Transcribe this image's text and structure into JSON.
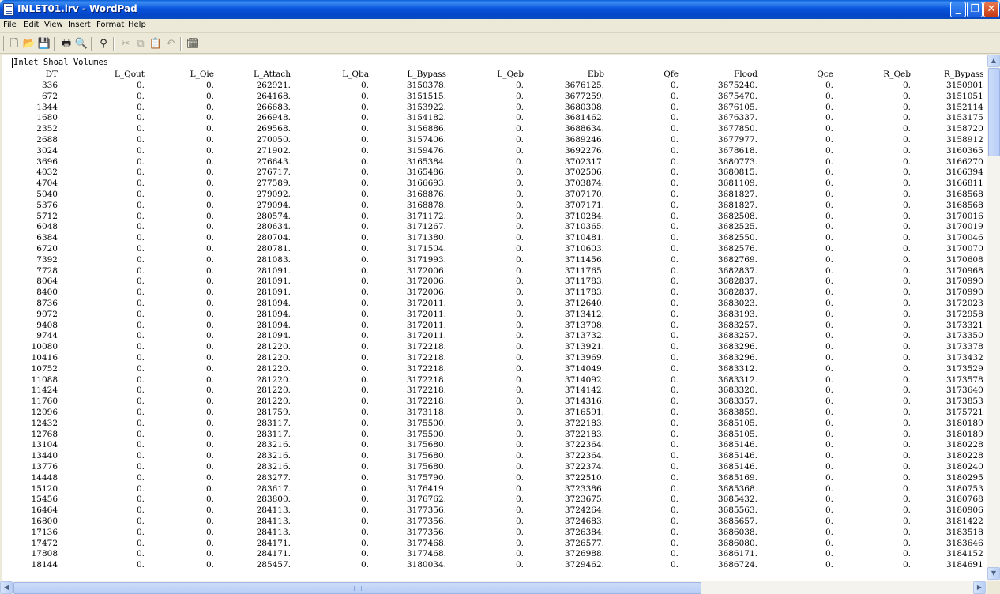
{
  "window": {
    "title": "INLET01.irv - WordPad",
    "minimize_glyph": "_",
    "maximize_glyph": "❐",
    "close_glyph": "✕"
  },
  "menu": [
    "File",
    "Edit",
    "View",
    "Insert",
    "Format",
    "Help"
  ],
  "toolbar": {
    "tools": [
      {
        "name": "new-icon",
        "glyph": "🗋"
      },
      {
        "name": "open-icon",
        "glyph": "📂"
      },
      {
        "name": "save-icon",
        "glyph": "💾"
      },
      {
        "name": "print-icon",
        "glyph": "🖶"
      },
      {
        "name": "print-preview-icon",
        "glyph": "🔍"
      },
      {
        "name": "find-icon",
        "glyph": "⚲"
      },
      {
        "name": "cut-icon",
        "glyph": "✂"
      },
      {
        "name": "copy-icon",
        "glyph": "⧉"
      },
      {
        "name": "paste-icon",
        "glyph": "📋"
      },
      {
        "name": "undo-icon",
        "glyph": "↶"
      },
      {
        "name": "date-time-icon",
        "glyph": "🗓"
      }
    ]
  },
  "document": {
    "title": "Inlet Shoal Volumes",
    "columns": [
      "DT",
      "L_Qout",
      "L_Qie",
      "L_Attach",
      "L_Qba",
      "L_Bypass",
      "L_Qeb",
      "Ebb",
      "Qfe",
      "Flood",
      "Qce",
      "R_Qeb",
      "R_Bypass"
    ],
    "rows": [
      [
        "336",
        "0.",
        "0.",
        "262921.",
        "0.",
        "3150378.",
        "0.",
        "3676125.",
        "0.",
        "3675240.",
        "0.",
        "0.",
        "3150901"
      ],
      [
        "672",
        "0.",
        "0.",
        "264168.",
        "0.",
        "3151515.",
        "0.",
        "3677259.",
        "0.",
        "3675470.",
        "0.",
        "0.",
        "3151051"
      ],
      [
        "1344",
        "0.",
        "0.",
        "266683.",
        "0.",
        "3153922.",
        "0.",
        "3680308.",
        "0.",
        "3676105.",
        "0.",
        "0.",
        "3152114"
      ],
      [
        "1680",
        "0.",
        "0.",
        "266948.",
        "0.",
        "3154182.",
        "0.",
        "3681462.",
        "0.",
        "3676337.",
        "0.",
        "0.",
        "3153175"
      ],
      [
        "2352",
        "0.",
        "0.",
        "269568.",
        "0.",
        "3156886.",
        "0.",
        "3688634.",
        "0.",
        "3677850.",
        "0.",
        "0.",
        "3158720"
      ],
      [
        "2688",
        "0.",
        "0.",
        "270050.",
        "0.",
        "3157406.",
        "0.",
        "3689246.",
        "0.",
        "3677977.",
        "0.",
        "0.",
        "3158912"
      ],
      [
        "3024",
        "0.",
        "0.",
        "271902.",
        "0.",
        "3159476.",
        "0.",
        "3692276.",
        "0.",
        "3678618.",
        "0.",
        "0.",
        "3160365"
      ],
      [
        "3696",
        "0.",
        "0.",
        "276643.",
        "0.",
        "3165384.",
        "0.",
        "3702317.",
        "0.",
        "3680773.",
        "0.",
        "0.",
        "3166270"
      ],
      [
        "4032",
        "0.",
        "0.",
        "276717.",
        "0.",
        "3165486.",
        "0.",
        "3702506.",
        "0.",
        "3680815.",
        "0.",
        "0.",
        "3166394"
      ],
      [
        "4704",
        "0.",
        "0.",
        "277589.",
        "0.",
        "3166693.",
        "0.",
        "3703874.",
        "0.",
        "3681109.",
        "0.",
        "0.",
        "3166811"
      ],
      [
        "5040",
        "0.",
        "0.",
        "279092.",
        "0.",
        "3168876.",
        "0.",
        "3707170.",
        "0.",
        "3681827.",
        "0.",
        "0.",
        "3168568"
      ],
      [
        "5376",
        "0.",
        "0.",
        "279094.",
        "0.",
        "3168878.",
        "0.",
        "3707171.",
        "0.",
        "3681827.",
        "0.",
        "0.",
        "3168568"
      ],
      [
        "5712",
        "0.",
        "0.",
        "280574.",
        "0.",
        "3171172.",
        "0.",
        "3710284.",
        "0.",
        "3682508.",
        "0.",
        "0.",
        "3170016"
      ],
      [
        "6048",
        "0.",
        "0.",
        "280634.",
        "0.",
        "3171267.",
        "0.",
        "3710365.",
        "0.",
        "3682525.",
        "0.",
        "0.",
        "3170019"
      ],
      [
        "6384",
        "0.",
        "0.",
        "280704.",
        "0.",
        "3171380.",
        "0.",
        "3710481.",
        "0.",
        "3682550.",
        "0.",
        "0.",
        "3170046"
      ],
      [
        "6720",
        "0.",
        "0.",
        "280781.",
        "0.",
        "3171504.",
        "0.",
        "3710603.",
        "0.",
        "3682576.",
        "0.",
        "0.",
        "3170070"
      ],
      [
        "7392",
        "0.",
        "0.",
        "281083.",
        "0.",
        "3171993.",
        "0.",
        "3711456.",
        "0.",
        "3682769.",
        "0.",
        "0.",
        "3170608"
      ],
      [
        "7728",
        "0.",
        "0.",
        "281091.",
        "0.",
        "3172006.",
        "0.",
        "3711765.",
        "0.",
        "3682837.",
        "0.",
        "0.",
        "3170968"
      ],
      [
        "8064",
        "0.",
        "0.",
        "281091.",
        "0.",
        "3172006.",
        "0.",
        "3711783.",
        "0.",
        "3682837.",
        "0.",
        "0.",
        "3170990"
      ],
      [
        "8400",
        "0.",
        "0.",
        "281091.",
        "0.",
        "3172006.",
        "0.",
        "3711783.",
        "0.",
        "3682837.",
        "0.",
        "0.",
        "3170990"
      ],
      [
        "8736",
        "0.",
        "0.",
        "281094.",
        "0.",
        "3172011.",
        "0.",
        "3712640.",
        "0.",
        "3683023.",
        "0.",
        "0.",
        "3172023"
      ],
      [
        "9072",
        "0.",
        "0.",
        "281094.",
        "0.",
        "3172011.",
        "0.",
        "3713412.",
        "0.",
        "3683193.",
        "0.",
        "0.",
        "3172958"
      ],
      [
        "9408",
        "0.",
        "0.",
        "281094.",
        "0.",
        "3172011.",
        "0.",
        "3713708.",
        "0.",
        "3683257.",
        "0.",
        "0.",
        "3173321"
      ],
      [
        "9744",
        "0.",
        "0.",
        "281094.",
        "0.",
        "3172011.",
        "0.",
        "3713732.",
        "0.",
        "3683257.",
        "0.",
        "0.",
        "3173350"
      ],
      [
        "10080",
        "0.",
        "0.",
        "281220.",
        "0.",
        "3172218.",
        "0.",
        "3713921.",
        "0.",
        "3683296.",
        "0.",
        "0.",
        "3173378"
      ],
      [
        "10416",
        "0.",
        "0.",
        "281220.",
        "0.",
        "3172218.",
        "0.",
        "3713969.",
        "0.",
        "3683296.",
        "0.",
        "0.",
        "3173432"
      ],
      [
        "10752",
        "0.",
        "0.",
        "281220.",
        "0.",
        "3172218.",
        "0.",
        "3714049.",
        "0.",
        "3683312.",
        "0.",
        "0.",
        "3173529"
      ],
      [
        "11088",
        "0.",
        "0.",
        "281220.",
        "0.",
        "3172218.",
        "0.",
        "3714092.",
        "0.",
        "3683312.",
        "0.",
        "0.",
        "3173578"
      ],
      [
        "11424",
        "0.",
        "0.",
        "281220.",
        "0.",
        "3172218.",
        "0.",
        "3714142.",
        "0.",
        "3683320.",
        "0.",
        "0.",
        "3173640"
      ],
      [
        "11760",
        "0.",
        "0.",
        "281220.",
        "0.",
        "3172218.",
        "0.",
        "3714316.",
        "0.",
        "3683357.",
        "0.",
        "0.",
        "3173853"
      ],
      [
        "12096",
        "0.",
        "0.",
        "281759.",
        "0.",
        "3173118.",
        "0.",
        "3716591.",
        "0.",
        "3683859.",
        "0.",
        "0.",
        "3175721"
      ],
      [
        "12432",
        "0.",
        "0.",
        "283117.",
        "0.",
        "3175500.",
        "0.",
        "3722183.",
        "0.",
        "3685105.",
        "0.",
        "0.",
        "3180189"
      ],
      [
        "12768",
        "0.",
        "0.",
        "283117.",
        "0.",
        "3175500.",
        "0.",
        "3722183.",
        "0.",
        "3685105.",
        "0.",
        "0.",
        "3180189"
      ],
      [
        "13104",
        "0.",
        "0.",
        "283216.",
        "0.",
        "3175680.",
        "0.",
        "3722364.",
        "0.",
        "3685146.",
        "0.",
        "0.",
        "3180228"
      ],
      [
        "13440",
        "0.",
        "0.",
        "283216.",
        "0.",
        "3175680.",
        "0.",
        "3722364.",
        "0.",
        "3685146.",
        "0.",
        "0.",
        "3180228"
      ],
      [
        "13776",
        "0.",
        "0.",
        "283216.",
        "0.",
        "3175680.",
        "0.",
        "3722374.",
        "0.",
        "3685146.",
        "0.",
        "0.",
        "3180240"
      ],
      [
        "14448",
        "0.",
        "0.",
        "283277.",
        "0.",
        "3175790.",
        "0.",
        "3722510.",
        "0.",
        "3685169.",
        "0.",
        "0.",
        "3180295"
      ],
      [
        "15120",
        "0.",
        "0.",
        "283617.",
        "0.",
        "3176419.",
        "0.",
        "3723386.",
        "0.",
        "3685368.",
        "0.",
        "0.",
        "3180753"
      ],
      [
        "15456",
        "0.",
        "0.",
        "283800.",
        "0.",
        "3176762.",
        "0.",
        "3723675.",
        "0.",
        "3685432.",
        "0.",
        "0.",
        "3180768"
      ],
      [
        "16464",
        "0.",
        "0.",
        "284113.",
        "0.",
        "3177356.",
        "0.",
        "3724264.",
        "0.",
        "3685563.",
        "0.",
        "0.",
        "3180906"
      ],
      [
        "16800",
        "0.",
        "0.",
        "284113.",
        "0.",
        "3177356.",
        "0.",
        "3724683.",
        "0.",
        "3685657.",
        "0.",
        "0.",
        "3181422"
      ],
      [
        "17136",
        "0.",
        "0.",
        "284113.",
        "0.",
        "3177356.",
        "0.",
        "3726384.",
        "0.",
        "3686038.",
        "0.",
        "0.",
        "3183518"
      ],
      [
        "17472",
        "0.",
        "0.",
        "284171.",
        "0.",
        "3177468.",
        "0.",
        "3726577.",
        "0.",
        "3686080.",
        "0.",
        "0.",
        "3183646"
      ],
      [
        "17808",
        "0.",
        "0.",
        "284171.",
        "0.",
        "3177468.",
        "0.",
        "3726988.",
        "0.",
        "3686171.",
        "0.",
        "0.",
        "3184152"
      ],
      [
        "18144",
        "0.",
        "0.",
        "285457.",
        "0.",
        "3180034.",
        "0.",
        "3729462.",
        "0.",
        "3686724.",
        "0.",
        "0.",
        "3184691"
      ]
    ]
  },
  "scrollbars": {
    "up_glyph": "▲",
    "down_glyph": "▼",
    "left_glyph": "◀",
    "right_glyph": "▶"
  }
}
